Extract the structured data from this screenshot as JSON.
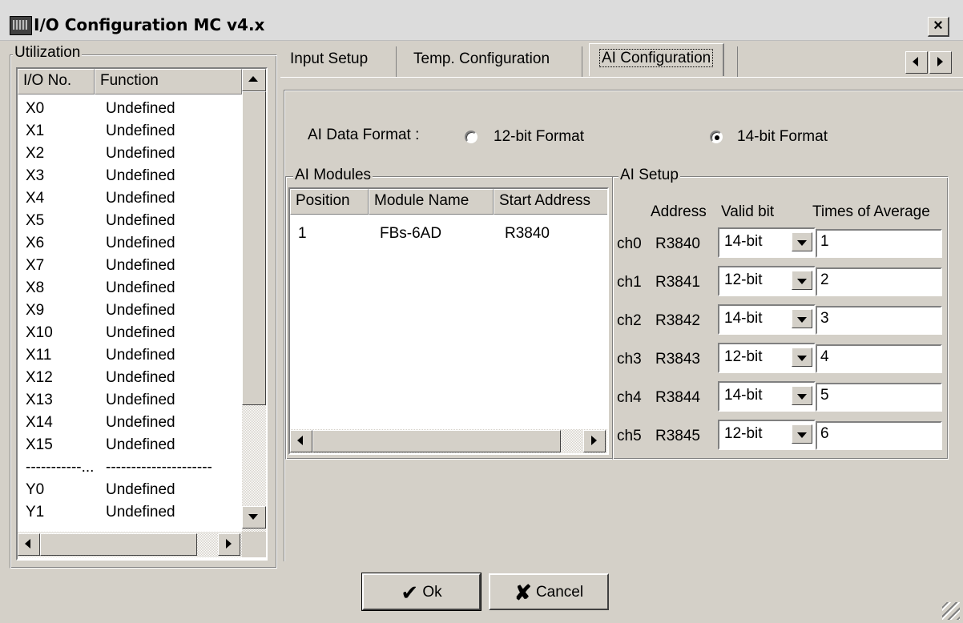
{
  "window": {
    "title": "I/O Configuration MC v4.x",
    "close_label": "×"
  },
  "utilization": {
    "group_label": "Utilization",
    "columns": [
      "I/O No.",
      "Function"
    ],
    "rows": [
      {
        "io": "X0",
        "fn": "Undefined"
      },
      {
        "io": "X1",
        "fn": "Undefined"
      },
      {
        "io": "X2",
        "fn": "Undefined"
      },
      {
        "io": "X3",
        "fn": "Undefined"
      },
      {
        "io": "X4",
        "fn": "Undefined"
      },
      {
        "io": "X5",
        "fn": "Undefined"
      },
      {
        "io": "X6",
        "fn": "Undefined"
      },
      {
        "io": "X7",
        "fn": "Undefined"
      },
      {
        "io": "X8",
        "fn": "Undefined"
      },
      {
        "io": "X9",
        "fn": "Undefined"
      },
      {
        "io": "X10",
        "fn": "Undefined"
      },
      {
        "io": "X11",
        "fn": "Undefined"
      },
      {
        "io": "X12",
        "fn": "Undefined"
      },
      {
        "io": "X13",
        "fn": "Undefined"
      },
      {
        "io": "X14",
        "fn": "Undefined"
      },
      {
        "io": "X15",
        "fn": "Undefined"
      },
      {
        "io": "-----------...",
        "fn": "---------------------"
      },
      {
        "io": "Y0",
        "fn": "Undefined"
      },
      {
        "io": "Y1",
        "fn": "Undefined"
      }
    ]
  },
  "tabs": [
    {
      "label": "Input Setup",
      "active": false
    },
    {
      "label": "Temp. Configuration",
      "active": false
    },
    {
      "label": "AI Configuration",
      "active": true
    }
  ],
  "ai_format": {
    "label": "AI Data Format :",
    "options": [
      {
        "label": "12-bit Format",
        "checked": false
      },
      {
        "label": "14-bit Format",
        "checked": true
      }
    ]
  },
  "ai_modules": {
    "group_label": "AI Modules",
    "columns": [
      "Position",
      "Module Name",
      "Start Address"
    ],
    "rows": [
      {
        "position": "1",
        "module": "FBs-6AD",
        "address": "R3840"
      }
    ]
  },
  "ai_setup": {
    "group_label": "AI Setup",
    "headers": {
      "address": "Address",
      "valid_bit": "Valid bit",
      "average": "Times of Average"
    },
    "channels": [
      {
        "ch": "ch0",
        "address": "R3840",
        "valid_bit": "14-bit",
        "average": "1"
      },
      {
        "ch": "ch1",
        "address": "R3841",
        "valid_bit": "12-bit",
        "average": "2"
      },
      {
        "ch": "ch2",
        "address": "R3842",
        "valid_bit": "14-bit",
        "average": "3"
      },
      {
        "ch": "ch3",
        "address": "R3843",
        "valid_bit": "12-bit",
        "average": "4"
      },
      {
        "ch": "ch4",
        "address": "R3844",
        "valid_bit": "14-bit",
        "average": "5"
      },
      {
        "ch": "ch5",
        "address": "R3845",
        "valid_bit": "12-bit",
        "average": "6"
      }
    ]
  },
  "buttons": {
    "ok_label": "Ok",
    "cancel_label": "Cancel"
  }
}
